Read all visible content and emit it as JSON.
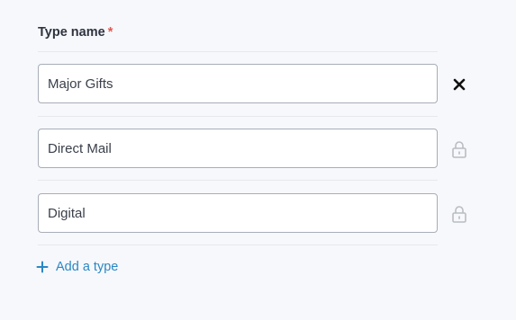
{
  "field": {
    "label": "Type name",
    "required_marker": "*"
  },
  "types": [
    {
      "value": "Major Gifts",
      "action_icon": "close-icon"
    },
    {
      "value": "Direct Mail",
      "action_icon": "lock-icon"
    },
    {
      "value": "Digital",
      "action_icon": "lock-icon"
    }
  ],
  "add_type": {
    "label": "Add a type",
    "icon": "plus-icon"
  },
  "colors": {
    "accent": "#2a87c5",
    "required": "#e05a4f",
    "lock": "#b9bcc2"
  }
}
